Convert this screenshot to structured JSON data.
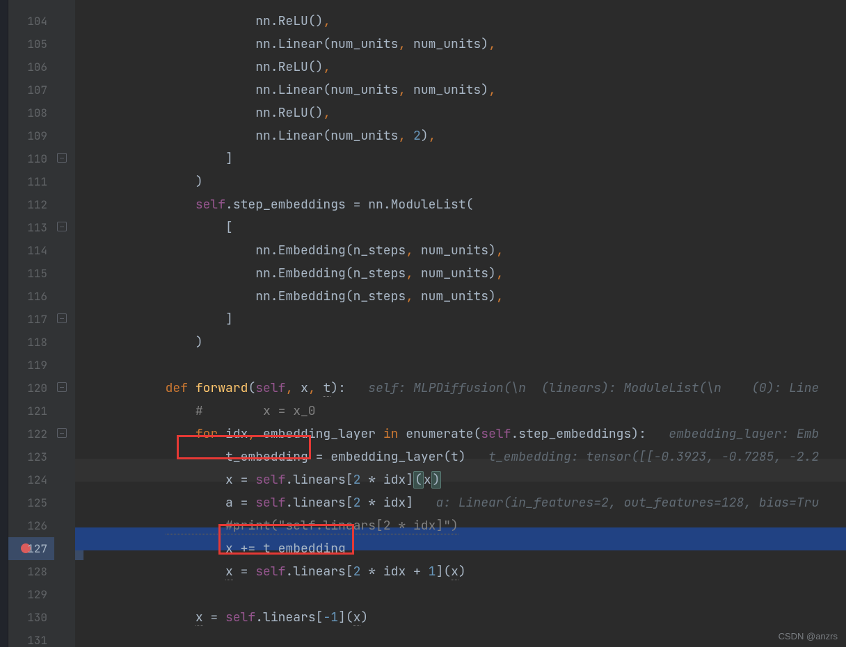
{
  "line_numbers": [
    104,
    105,
    106,
    107,
    108,
    109,
    110,
    111,
    112,
    113,
    114,
    115,
    116,
    117,
    118,
    119,
    120,
    121,
    122,
    123,
    124,
    125,
    126,
    127,
    128,
    129,
    130,
    131
  ],
  "code": {
    "l104": "            nn.ReLU(),",
    "l105": "            nn.Linear(num_units, num_units),",
    "l106": "            nn.ReLU(),",
    "l107": "            nn.Linear(num_units, num_units),",
    "l108": "            nn.ReLU(),",
    "l109_a": "            nn.Linear(num_units",
    "l109_b": ", ",
    "l109_c": "2",
    "l109_d": "),",
    "l110": "        ]",
    "l111": "    )",
    "l112_a": "    ",
    "l112_b": "self",
    "l112_c": ".step_embeddings = nn.ModuleList(",
    "l113": "        [",
    "l114": "            nn.Embedding(n_steps, num_units),",
    "l115": "            nn.Embedding(n_steps, num_units),",
    "l116": "            nn.Embedding(n_steps, num_units),",
    "l117": "        ]",
    "l118": "    )",
    "l119": "",
    "l120_def": "def",
    "l120_fn": "forward",
    "l120_open": "(",
    "l120_self": "self",
    "l120_c1": ", ",
    "l120_x": "x",
    "l120_c2": ", ",
    "l120_t": "t",
    "l120_close": "):",
    "l120_hint": "   self: MLPDiffusion(\\n  (linears): ModuleList(\\n    (0): Line",
    "l121": "    #        x = x_0",
    "l122_for": "    for",
    "l122_a": " idx",
    "l122_c1": ", ",
    "l122_b": "embedding_layer ",
    "l122_in": "in",
    "l122_c": " enumerate(",
    "l122_self": "self",
    "l122_d": ".step_embeddings):",
    "l122_hint": "   embedding_layer: Emb",
    "l123_a": "        t_embedding = ",
    "l123_b": "embedding_layer(t)",
    "l123_hint": "   t_embedding: tensor([[-0.3923, -0.7285, -2.2",
    "l124_a": "        x = ",
    "l124_self": "self",
    "l124_b": ".linears[",
    "l124_c": "2",
    "l124_d": " * idx]",
    "l124_e": "(",
    "l124_f": "x",
    "l124_g": ")",
    "l125_a": "        a = ",
    "l125_self": "self",
    "l125_b": ".linears[",
    "l125_c": "2",
    "l125_d": " * idx]",
    "l125_hint": "   a: Linear(in_features=2, out_features=128, bias=Tru",
    "l126": "        #print(\"self.linears[2 * idx]\")",
    "l127": "        x += t_embedding",
    "l128_a": "        ",
    "l128_x": "x",
    "l128_b": " = ",
    "l128_self": "self",
    "l128_c": ".linears[",
    "l128_d": "2",
    "l128_e": " * idx + ",
    "l128_f": "1",
    "l128_g": "](",
    "l128_h": "x",
    "l128_i": ")",
    "l129": "",
    "l130_a": "    ",
    "l130_x": "x",
    "l130_b": " = ",
    "l130_self": "self",
    "l130_c": ".linears[",
    "l130_d": "-1",
    "l130_e": "](",
    "l130_f": "x",
    "l130_g": ")",
    "l131": ""
  },
  "indent_unit": "    ",
  "indent": {
    "l104": "                        ",
    "l110": "                    ",
    "l111": "                ",
    "l112": "                ",
    "l113": "                    ",
    "l114": "                        ",
    "l117": "                    ",
    "l118": "                ",
    "l120": "            ",
    "l121": "                ",
    "l122": "                ",
    "l123": "            ",
    "l127": "            ",
    "l128": "            ",
    "l130": "            "
  },
  "watermark": "CSDN @anzrs"
}
